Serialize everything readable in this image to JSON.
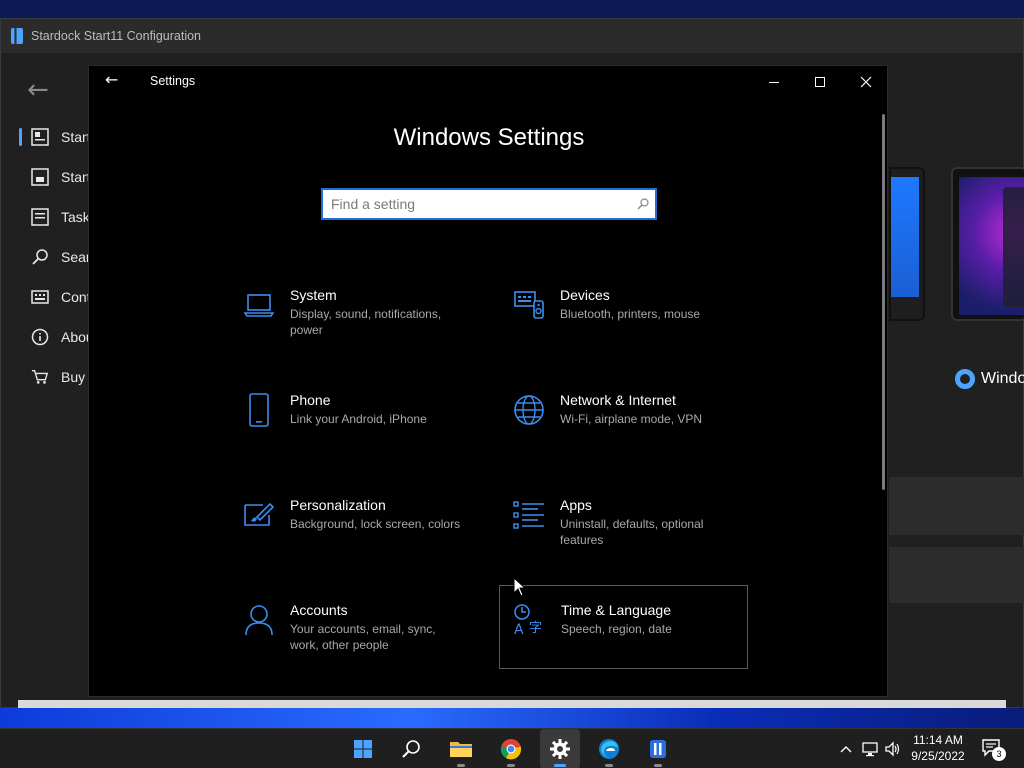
{
  "stardock": {
    "window_title": "Stardock Start11 Configuration",
    "nav_items": [
      {
        "label": "Start",
        "icon": "start-menu-icon"
      },
      {
        "label": "Start",
        "icon": "start-button-icon"
      },
      {
        "label": "Taskb",
        "icon": "taskbar-icon"
      },
      {
        "label": "Sear",
        "icon": "search-icon"
      },
      {
        "label": "Cont",
        "icon": "keyboard-icon"
      },
      {
        "label": "Abou",
        "icon": "info-icon"
      },
      {
        "label": "Buy",
        "icon": "cart-icon"
      }
    ],
    "radio_label": "Windo"
  },
  "settings": {
    "window_title": "Settings",
    "heading": "Windows Settings",
    "search_placeholder": "Find a setting",
    "tiles": [
      {
        "name": "System",
        "desc": "Display, sound, notifications, power",
        "icon": "laptop-icon"
      },
      {
        "name": "Devices",
        "desc": "Bluetooth, printers, mouse",
        "icon": "devices-icon"
      },
      {
        "name": "Phone",
        "desc": "Link your Android, iPhone",
        "icon": "phone-icon"
      },
      {
        "name": "Network & Internet",
        "desc": "Wi-Fi, airplane mode, VPN",
        "icon": "globe-icon"
      },
      {
        "name": "Personalization",
        "desc": "Background, lock screen, colors",
        "icon": "paint-icon"
      },
      {
        "name": "Apps",
        "desc": "Uninstall, defaults, optional features",
        "icon": "apps-list-icon"
      },
      {
        "name": "Accounts",
        "desc": "Your accounts, email, sync, work, other people",
        "icon": "person-icon"
      },
      {
        "name": "Time & Language",
        "desc": "Speech, region, date",
        "icon": "time-language-icon"
      }
    ]
  },
  "taskbar": {
    "apps": [
      {
        "name": "start",
        "icon": "windows-start-icon"
      },
      {
        "name": "search",
        "icon": "search-icon"
      },
      {
        "name": "file-explorer",
        "icon": "folder-icon"
      },
      {
        "name": "chrome",
        "icon": "chrome-icon"
      },
      {
        "name": "settings",
        "icon": "gear-icon"
      },
      {
        "name": "edge",
        "icon": "edge-icon"
      },
      {
        "name": "start11",
        "icon": "start11-icon"
      }
    ],
    "time": "11:14 AM",
    "date": "9/25/2022",
    "notification_count": "3"
  },
  "colors": {
    "accent": "#1e6fd9",
    "icon_blue": "#3a8ef0"
  }
}
